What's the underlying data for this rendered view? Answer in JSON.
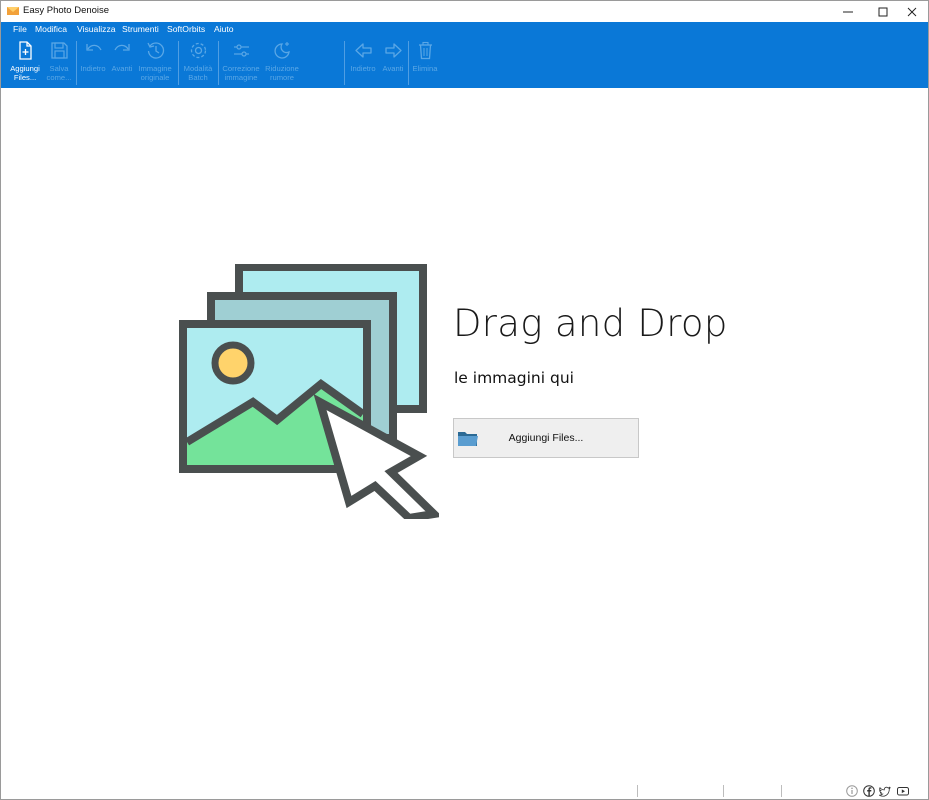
{
  "window": {
    "title": "Easy Photo Denoise",
    "controls": {
      "minimize": "—",
      "maximize": "☐",
      "close": "✕"
    }
  },
  "menu": [
    "File",
    "Modifica",
    "Visualizza",
    "Strumenti",
    "SoftOrbits",
    "Aiuto"
  ],
  "toolbar": [
    {
      "label": "Aggiungi\nFiles...",
      "icon": "add-file-icon",
      "enabled": true
    },
    {
      "label": "Salva\ncome...",
      "icon": "save-icon",
      "enabled": false
    },
    {
      "label": "Indietro",
      "icon": "undo-icon",
      "enabled": false
    },
    {
      "label": "Avanti",
      "icon": "redo-icon",
      "enabled": false
    },
    {
      "label": "Immagine\noriginale",
      "icon": "history-icon",
      "enabled": false
    },
    {
      "label": "Modalità\nBatch",
      "icon": "gear-icon",
      "enabled": false
    },
    {
      "label": "Correzione\nimmagine",
      "icon": "sliders-icon",
      "enabled": false
    },
    {
      "label": "Riduzione\nrumore",
      "icon": "moon-sparkle-icon",
      "enabled": false
    },
    {
      "label": "Indietro",
      "icon": "arrow-left-icon",
      "enabled": false
    },
    {
      "label": "Avanti",
      "icon": "arrow-right-icon",
      "enabled": false
    },
    {
      "label": "Elimina",
      "icon": "trash-icon",
      "enabled": false
    }
  ],
  "dropzone": {
    "title": "Drag and Drop",
    "subtitle": "le immagini qui",
    "button_label": "Aggiungi Files..."
  },
  "status_icons": [
    "info-icon",
    "facebook-icon",
    "twitter-icon",
    "youtube-icon"
  ],
  "colors": {
    "ribbon": "#0a78d7",
    "photo_sky": "#aeecf0",
    "photo_frame": "#4a4f4f",
    "sun": "#ffd36b",
    "hills": "#74e39a"
  }
}
